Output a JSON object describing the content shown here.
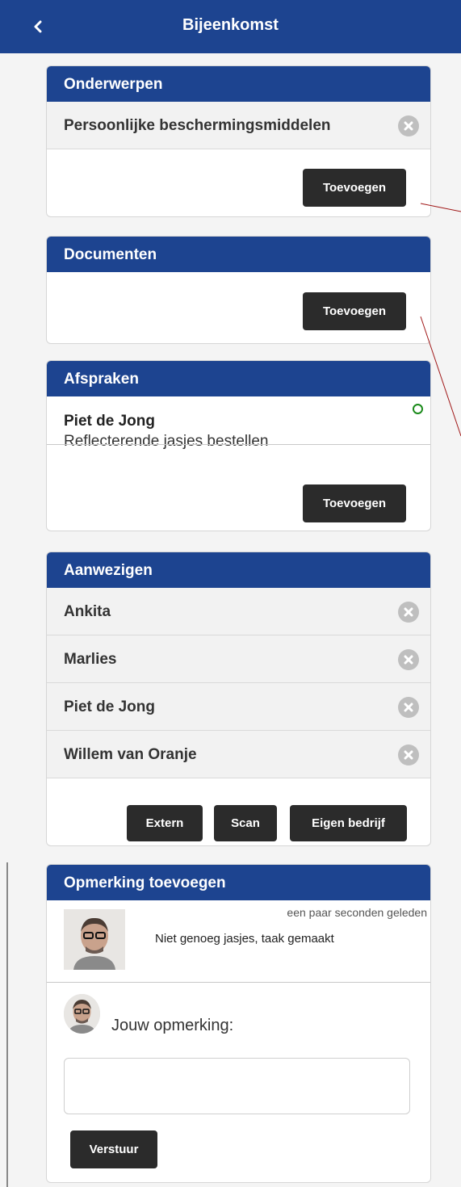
{
  "header": {
    "title": "Bijeenkomst",
    "back_icon": "chevron-left-icon"
  },
  "topics": {
    "title": "Onderwerpen",
    "items": [
      "Persoonlijke beschermingsmiddelen"
    ],
    "add_label": "Toevoegen"
  },
  "documents": {
    "title": "Documenten",
    "add_label": "Toevoegen"
  },
  "agreements": {
    "title": "Afspraken",
    "items": [
      {
        "person": "Piet de Jong",
        "text": "Reflecterende jasjes bestellen",
        "status_icon": "open-circle-icon",
        "status_color": "#1a8a1a"
      }
    ],
    "add_label": "Toevoegen"
  },
  "attendees": {
    "title": "Aanwezigen",
    "items": [
      "Ankita",
      "Marlies",
      "Piet de Jong",
      "Willem van Oranje"
    ],
    "buttons": [
      "Extern",
      "Scan",
      "Eigen bedrijf"
    ]
  },
  "comments": {
    "title": "Opmerking toevoegen",
    "entries": [
      {
        "time": "een paar seconden geleden",
        "text": "Niet genoeg jasjes, taak gemaakt"
      }
    ],
    "prompt": "Jouw opmerking:",
    "input_value": "",
    "submit_label": "Verstuur"
  },
  "colors": {
    "primary": "#1d4490",
    "button": "#2b2b2b",
    "background": "#f4f4f4"
  }
}
